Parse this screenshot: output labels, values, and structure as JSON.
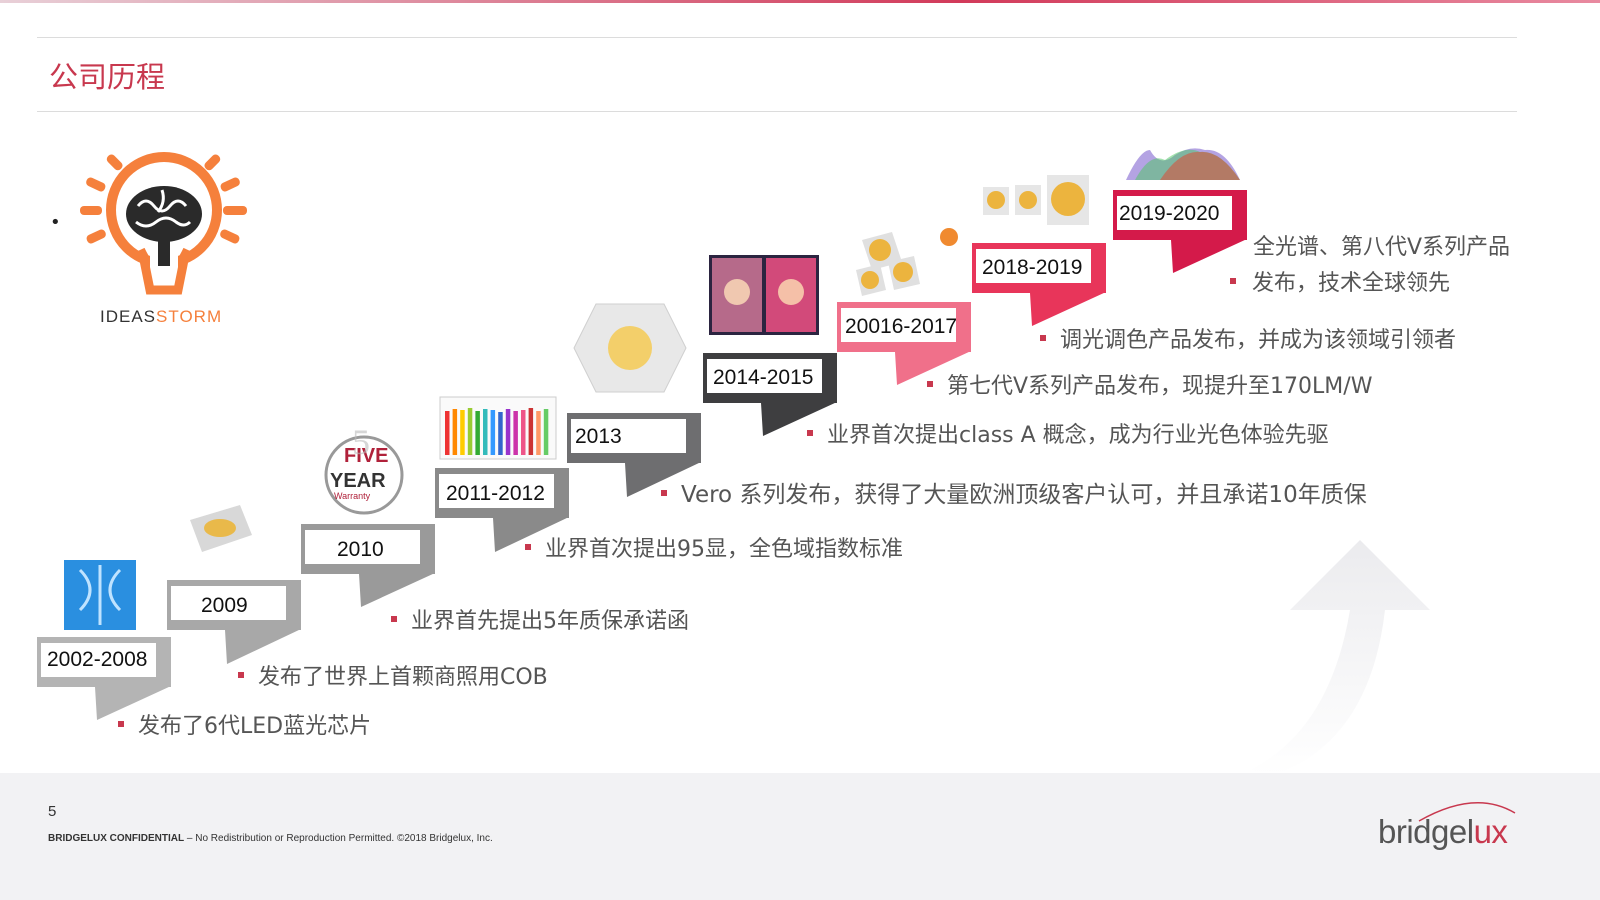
{
  "slide": {
    "title": "公司历程",
    "bullet_mark": "•",
    "page_number": "5",
    "confidential_bold": "BRIDGELUX CONFIDENTIAL",
    "confidential_rest": " – No Redistribution or Reproduction Permitted. ©2018 Bridgelux, Inc."
  },
  "logo": {
    "part1": "IDEAS",
    "part2": "STORM"
  },
  "timeline": {
    "years": [
      "2002-2008",
      "2009",
      "2010",
      "2011-2012",
      "2013",
      "2014-2015",
      "20016-2017",
      "2018-2019",
      "2019-2020"
    ],
    "bullets": [
      "发布了6代LED蓝光芯片",
      "发布了世界上首颗商照用COB",
      "业界首先提出5年质保承诺函",
      "业界首次提出95显，全色域指数标准",
      "Vero 系列发布，获得了大量欧洲顶级客户认可，并且承诺10年质保",
      "业界首次提出class A 概念，成为行业光色体验先驱",
      "第七代V系列产品发布，现提升至170LM/W",
      "调光调色产品发布，并成为该领域引领者",
      "全光谱、第八代V系列产品",
      "发布，技术全球领先"
    ]
  },
  "badges": {
    "warranty_line1": "FIVE",
    "warranty_line2": "YEAR",
    "warranty_line3": "Warranty",
    "warranty_number": "5"
  },
  "brand": {
    "name_main": "bridgel",
    "name_accent": "ux"
  },
  "colors": {
    "accent": "#c8384e",
    "orange": "#f5803c",
    "grey": "#8c8c8c",
    "pink": "#e8355a",
    "crimson": "#d41a4a"
  }
}
